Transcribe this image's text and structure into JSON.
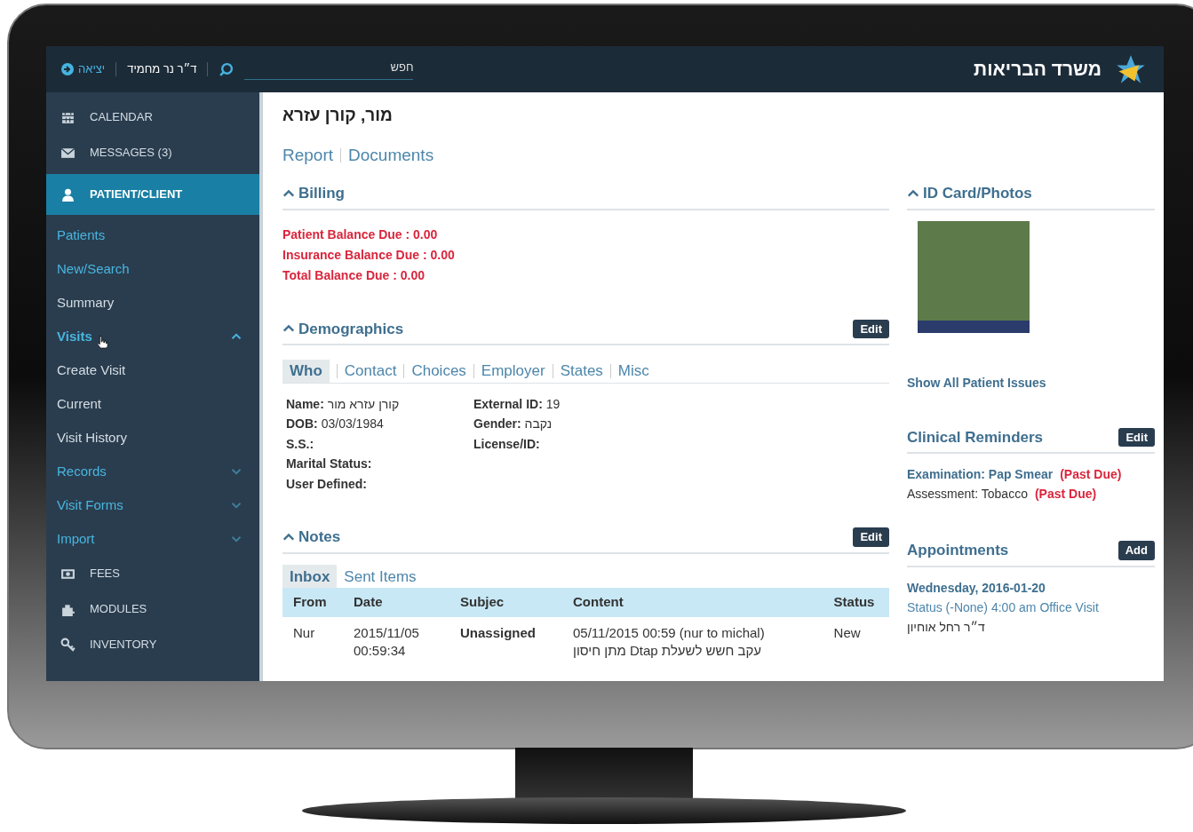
{
  "header": {
    "logo_text": "משרד הבריאות",
    "search": {
      "placeholder": "חפש"
    },
    "user": "ד״ר נר מחמיד",
    "logout": "יציאה"
  },
  "sidebar": {
    "items": [
      {
        "kind": "main",
        "label": "CALENDAR",
        "selected": false
      },
      {
        "kind": "main",
        "label": "MESSAGES (3)",
        "selected": false
      },
      {
        "kind": "main",
        "label": "PATIENT/CLIENT",
        "selected": true
      },
      {
        "kind": "link",
        "label": "Patients"
      },
      {
        "kind": "link",
        "label": "New/Search"
      },
      {
        "kind": "item",
        "label": "Summary"
      },
      {
        "kind": "group",
        "label": "Visits",
        "expanded": true,
        "hovered": true
      },
      {
        "kind": "item",
        "label": "Create Visit"
      },
      {
        "kind": "item",
        "label": "Current"
      },
      {
        "kind": "item",
        "label": "Visit History"
      },
      {
        "kind": "group",
        "label": "Records",
        "expanded": false,
        "hovered": false
      },
      {
        "kind": "group",
        "label": "Visit Forms",
        "expanded": false,
        "hovered": false
      },
      {
        "kind": "group",
        "label": "Import",
        "expanded": false,
        "hovered": false
      },
      {
        "kind": "main",
        "label": "FEES",
        "selected": false
      },
      {
        "kind": "main",
        "label": "MODULES",
        "selected": false
      },
      {
        "kind": "main",
        "label": "INVENTORY",
        "selected": false
      }
    ]
  },
  "patient": {
    "name": "מור, קורן עזרא",
    "links": [
      "Report",
      "Documents"
    ]
  },
  "billing": {
    "title": "Billing",
    "lines": [
      "Patient Balance Due : 0.00",
      "Insurance Balance Due : 0.00",
      "Total Balance Due : 0.00"
    ]
  },
  "demographics": {
    "title": "Demographics",
    "edit": "Edit",
    "tabs": [
      {
        "label": "Who",
        "selected": true
      },
      {
        "label": "Contact",
        "selected": false
      },
      {
        "label": "Choices",
        "selected": false
      },
      {
        "label": "Employer",
        "selected": false
      },
      {
        "label": "States",
        "selected": false
      },
      {
        "label": "Misc",
        "selected": false
      }
    ],
    "fields_left": [
      {
        "label": "Name:",
        "value": "קורן עזרא מור"
      },
      {
        "label": "DOB:",
        "value": "03/03/1984"
      },
      {
        "label": "S.S.:"
      },
      {
        "label": "Marital Status:"
      },
      {
        "label": "User Defined:"
      }
    ],
    "fields_right": [
      {
        "label": "External ID:",
        "value": "19"
      },
      {
        "label": "Gender:",
        "value": "נקבה"
      },
      {
        "label": "License/ID:"
      }
    ]
  },
  "notes": {
    "title": "Notes",
    "edit": "Edit",
    "tabs": [
      {
        "label": "Inbox",
        "selected": true
      },
      {
        "label": "Sent Items",
        "selected": false
      }
    ],
    "columns": [
      "From",
      "Date",
      "Subjec",
      "Content",
      "Status"
    ],
    "rows": [
      {
        "from": "Nur",
        "date": [
          "2015/11/05",
          "00:59:34"
        ],
        "subject": "Unassigned",
        "content": [
          "05/11/2015 00:59 (nur to michal)",
          "עקב חשש לשעלת Dtap מתן חיסון"
        ],
        "status": "New"
      }
    ]
  },
  "id_card": {
    "title": "ID Card/Photos"
  },
  "issues_link": "Show All Patient Issues",
  "clinical_reminders": {
    "title": "Clinical Reminders",
    "edit": "Edit",
    "items": [
      {
        "kind": "link",
        "text": "Examination: Pap Smear",
        "flag": "(Past Due)"
      },
      {
        "kind": "plain",
        "text": "Assessment: Tobacco",
        "flag": "(Past Due)"
      }
    ]
  },
  "appointments": {
    "title": "Appointments",
    "add": "Add",
    "items": [
      {
        "date": "Wednesday, 2016-01-20",
        "details": "Status (-None) 4:00 am Office Visit",
        "provider": "ד״ר רחל אוחיון"
      }
    ]
  }
}
